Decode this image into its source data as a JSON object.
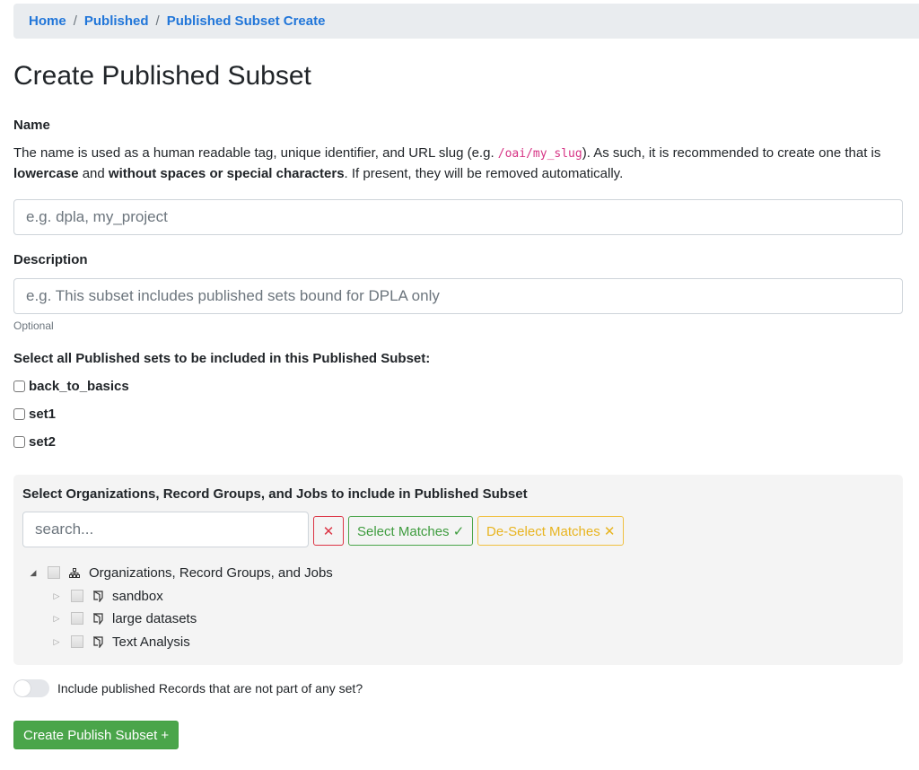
{
  "breadcrumb": {
    "items": [
      "Home",
      "Published",
      "Published Subset Create"
    ],
    "separator": "/"
  },
  "page_title": "Create Published Subset",
  "name_section": {
    "label": "Name",
    "help_part1": "The name is used as a human readable tag, unique identifier, and URL slug (e.g. ",
    "help_code": "/oai/my_slug",
    "help_part2": "). As such, it is recommended to create one that is ",
    "help_bold1": "lowercase",
    "help_part3": " and ",
    "help_bold2": "without spaces or special characters",
    "help_part4": ". If present, they will be removed automatically.",
    "placeholder": "e.g. dpla, my_project",
    "value": ""
  },
  "description_section": {
    "label": "Description",
    "placeholder": "e.g. This subset includes published sets bound for DPLA only",
    "value": "",
    "hint": "Optional"
  },
  "sets_section": {
    "label": "Select all Published sets to be included in this Published Subset:",
    "sets": [
      {
        "name": "back_to_basics",
        "checked": false
      },
      {
        "name": "set1",
        "checked": false
      },
      {
        "name": "set2",
        "checked": false
      }
    ]
  },
  "tree_panel": {
    "title": "Select Organizations, Record Groups, and Jobs to include in Published Subset",
    "search_placeholder": "search...",
    "search_value": "",
    "clear_label": "✕",
    "select_matches_label": "Select Matches ✓",
    "deselect_matches_label": "De-Select Matches ✕",
    "root": {
      "label": "Organizations, Record Groups, and Jobs",
      "expanded": true,
      "icon": "sitemap-icon",
      "children": [
        {
          "label": "sandbox",
          "icon": "organization-icon",
          "expanded": false
        },
        {
          "label": "large datasets",
          "icon": "organization-icon",
          "expanded": false
        },
        {
          "label": "Text Analysis",
          "icon": "organization-icon",
          "expanded": false
        }
      ]
    }
  },
  "include_unset_toggle": {
    "label": "Include published Records that are not part of any set?",
    "on": false
  },
  "submit_label": "Create Publish Subset +",
  "colors": {
    "link": "#2176d9",
    "success": "#4aa54a",
    "danger": "#dc3545",
    "warning": "#e8b41f",
    "code": "#d63384"
  }
}
